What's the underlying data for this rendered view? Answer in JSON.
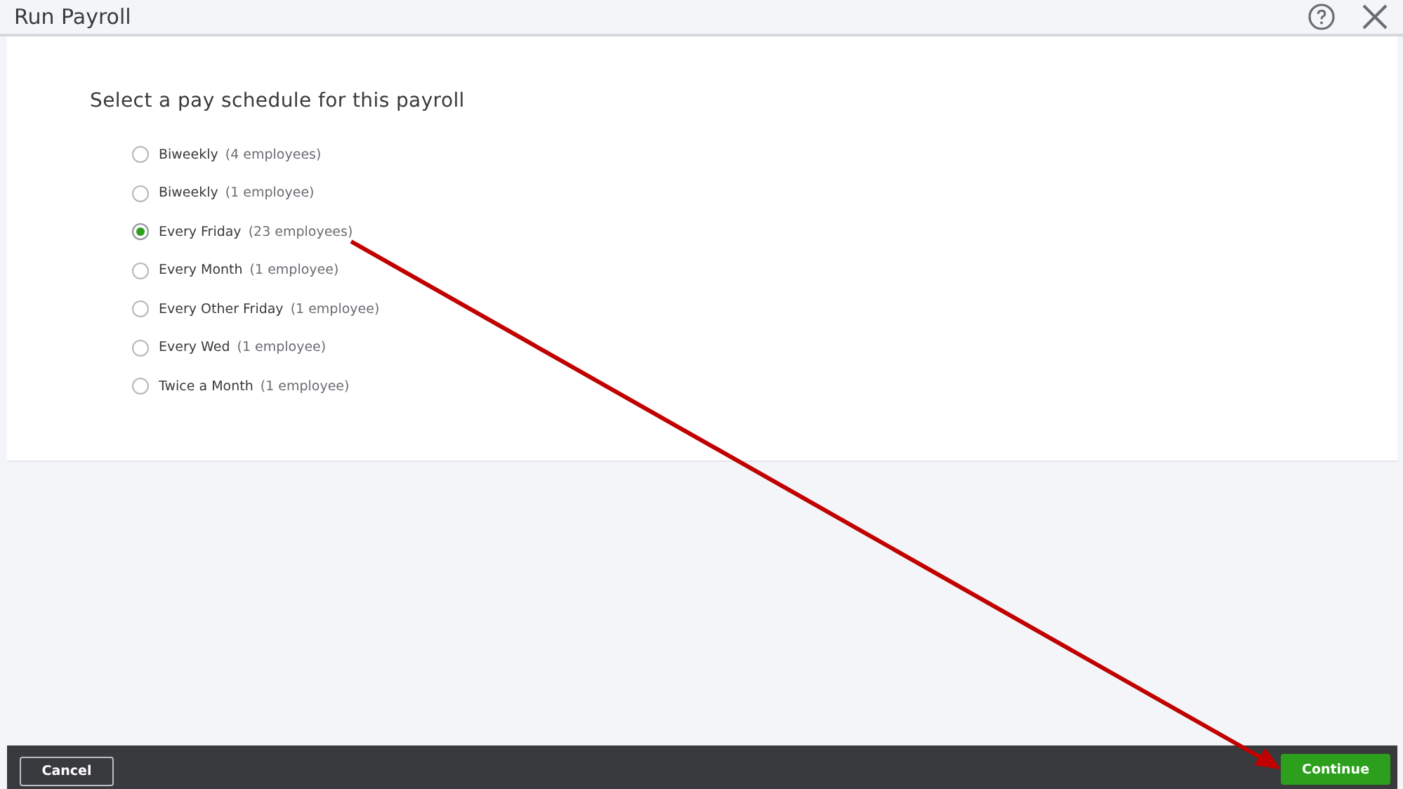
{
  "window": {
    "title": "Run Payroll"
  },
  "heading": "Select a pay schedule for this payroll",
  "schedules": [
    {
      "name": "Biweekly",
      "count": "(4 employees)",
      "selected": false
    },
    {
      "name": "Biweekly",
      "count": "(1 employee)",
      "selected": false
    },
    {
      "name": "Every Friday",
      "count": "(23 employees)",
      "selected": true
    },
    {
      "name": "Every Month",
      "count": "(1 employee)",
      "selected": false
    },
    {
      "name": "Every Other Friday",
      "count": "(1 employee)",
      "selected": false
    },
    {
      "name": "Every Wed",
      "count": "(1 employee)",
      "selected": false
    },
    {
      "name": "Twice a Month",
      "count": "(1 employee)",
      "selected": false
    }
  ],
  "buttons": {
    "cancel": "Cancel",
    "continue": "Continue"
  }
}
